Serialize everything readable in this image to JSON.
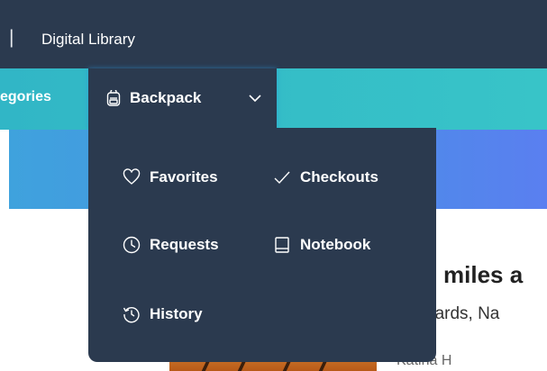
{
  "header": {
    "separator": "|",
    "brand": "Digital Library"
  },
  "nav": {
    "categories_label": "egories",
    "backpack_label": "Backpack",
    "backpack_icon": "backpack-icon"
  },
  "dropdown": {
    "items": [
      {
        "label": "Favorites",
        "icon": "heart-icon"
      },
      {
        "label": "Checkouts",
        "icon": "check-icon"
      },
      {
        "label": "Requests",
        "icon": "clock-icon"
      },
      {
        "label": "Notebook",
        "icon": "notebook-icon"
      },
      {
        "label": "History",
        "icon": "history-icon"
      }
    ]
  },
  "content": {
    "title_fragment": "miles a",
    "authors_fragment": "hards, Na",
    "extra_fragment": "Katina  H"
  },
  "colors": {
    "dark": "#2b3a4f",
    "teal": "#31b6c6",
    "blue": "#4a8fe6"
  }
}
